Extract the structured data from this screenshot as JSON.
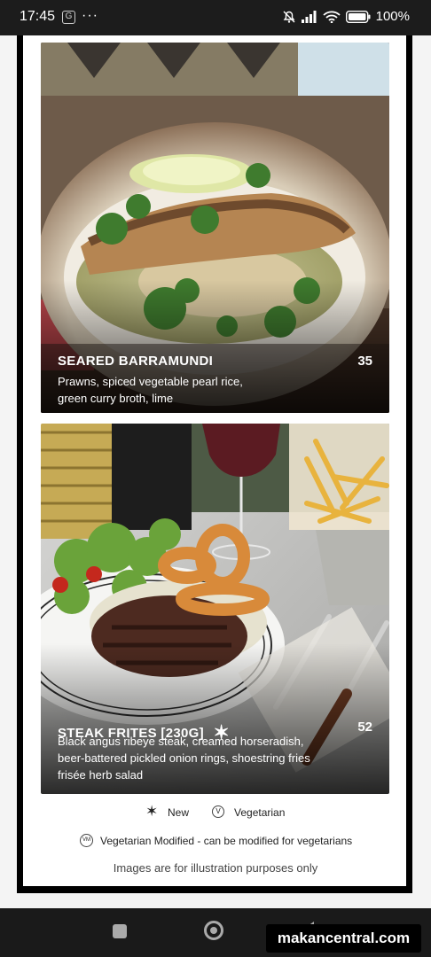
{
  "status_bar": {
    "time": "17:45",
    "app_icon": "G",
    "more": "···",
    "battery": "100%",
    "icons": [
      "mute-icon",
      "signal-icon",
      "wifi-icon",
      "battery-icon"
    ]
  },
  "menu": {
    "items": [
      {
        "title": "SEARED BARRAMUNDI",
        "price": "35",
        "description": "Prawns, spiced vegetable pearl rice, green curry broth, lime",
        "is_new": false
      },
      {
        "title": "STEAK FRITES [230G]",
        "price": "52",
        "description": "Black angus ribeye steak, creamed horseradish, beer-battered pickled onion rings, shoestring fries frisée herb salad",
        "is_new": true
      }
    ],
    "new_marker": "✶"
  },
  "legend": {
    "new_label": "New",
    "vegetarian_symbol": "V",
    "vegetarian_label": "Vegetarian",
    "vm_symbol": "VM",
    "vm_label": "Vegetarian Modified - can be modified for vegetarians",
    "disclaimer": "Images are for illustration purposes only"
  },
  "watermark": "makancentral.com",
  "colors": {
    "accent": "#ffffff",
    "background": "#f4f4f4"
  }
}
